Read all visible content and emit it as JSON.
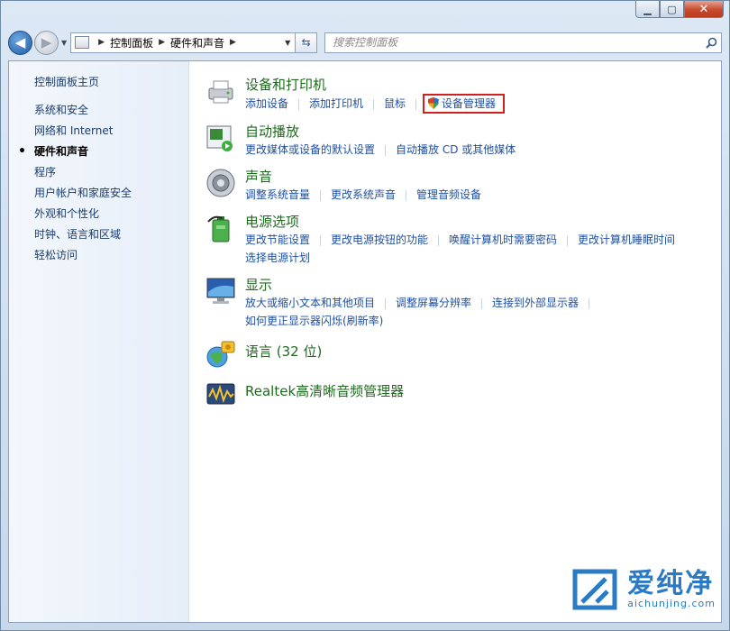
{
  "nav": {
    "breadcrumb": [
      "控制面板",
      "硬件和声音"
    ],
    "search_placeholder": "搜索控制面板"
  },
  "sidebar": {
    "home": "控制面板主页",
    "items": [
      "系统和安全",
      "网络和 Internet",
      "硬件和声音",
      "程序",
      "用户帐户和家庭安全",
      "外观和个性化",
      "时钟、语言和区域",
      "轻松访问"
    ],
    "active_index": 2
  },
  "categories": {
    "devices": {
      "title": "设备和打印机",
      "links": [
        "添加设备",
        "添加打印机",
        "鼠标",
        "设备管理器"
      ]
    },
    "autoplay": {
      "title": "自动播放",
      "links": [
        "更改媒体或设备的默认设置",
        "自动播放 CD 或其他媒体"
      ]
    },
    "sound": {
      "title": "声音",
      "links": [
        "调整系统音量",
        "更改系统声音",
        "管理音频设备"
      ]
    },
    "power": {
      "title": "电源选项",
      "links": [
        "更改节能设置",
        "更改电源按钮的功能",
        "唤醒计算机时需要密码",
        "更改计算机睡眠时间",
        "选择电源计划"
      ]
    },
    "display": {
      "title": "显示",
      "links": [
        "放大或缩小文本和其他项目",
        "调整屏幕分辨率",
        "连接到外部显示器",
        "如何更正显示器闪烁(刷新率)"
      ]
    },
    "language": {
      "title": "语言 (32 位)"
    },
    "realtek": {
      "title": "Realtek高清晰音频管理器"
    }
  },
  "watermark": {
    "text": "爱纯净",
    "url": "aichunjing.com"
  },
  "colors": {
    "category_title": "#1e6b1e",
    "link": "#1f4fa0",
    "highlight_box": "#d02020"
  }
}
